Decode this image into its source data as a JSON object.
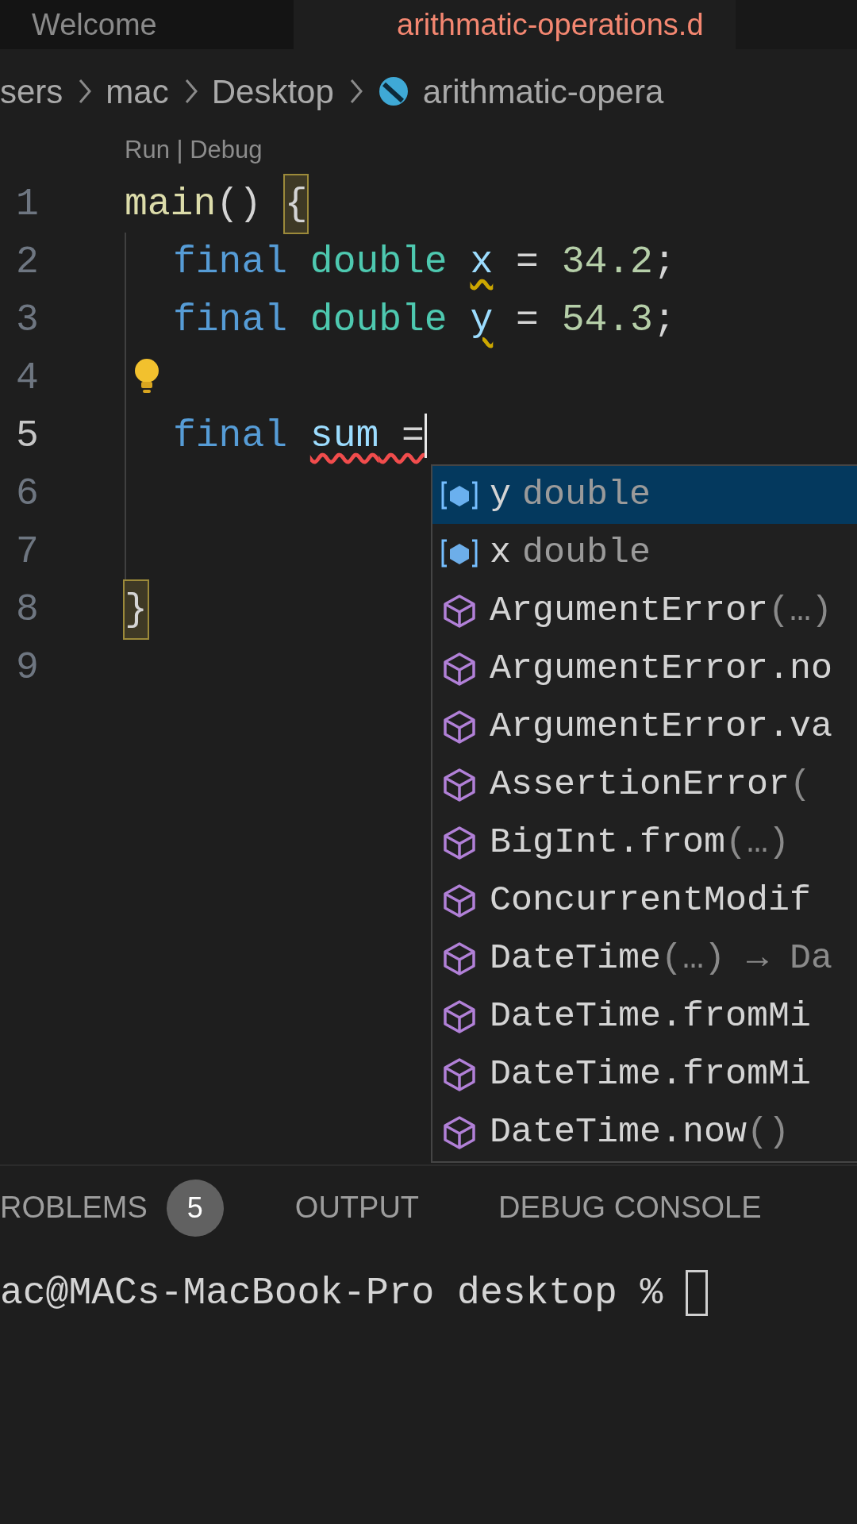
{
  "tabs": [
    {
      "label": "Welcome",
      "selected": false
    },
    {
      "label": "arithmatic-operations.d",
      "selected": true
    }
  ],
  "breadcrumb": [
    {
      "label": "sers",
      "kind": "folder"
    },
    {
      "label": "mac",
      "kind": "folder"
    },
    {
      "label": "Desktop",
      "kind": "folder"
    },
    {
      "label": "arithmatic-opera",
      "kind": "file"
    }
  ],
  "codelens": "Run | Debug",
  "lines": [
    {
      "number": "1",
      "current": false,
      "indented": false,
      "lightbulb": false,
      "cursor": false,
      "tokens": [
        {
          "text": "main",
          "kind": "function"
        },
        {
          "text": "() ",
          "kind": "punct"
        },
        {
          "text": "{",
          "kind": "punct",
          "bracket_match": true
        }
      ]
    },
    {
      "number": "2",
      "current": false,
      "indented": true,
      "lightbulb": false,
      "cursor": false,
      "tokens": [
        {
          "text": "final ",
          "kind": "keyword"
        },
        {
          "text": "double ",
          "kind": "type"
        },
        {
          "text": "x",
          "kind": "variable",
          "warning": true
        },
        {
          "text": " = ",
          "kind": "punct"
        },
        {
          "text": "34.2",
          "kind": "number"
        },
        {
          "text": ";",
          "kind": "punct"
        }
      ]
    },
    {
      "number": "3",
      "current": false,
      "indented": true,
      "lightbulb": false,
      "cursor": false,
      "tokens": [
        {
          "text": "final ",
          "kind": "keyword"
        },
        {
          "text": "double ",
          "kind": "type"
        },
        {
          "text": "y",
          "kind": "variable",
          "warning": true
        },
        {
          "text": " = ",
          "kind": "punct"
        },
        {
          "text": "54.3",
          "kind": "number"
        },
        {
          "text": ";",
          "kind": "punct"
        }
      ]
    },
    {
      "number": "4",
      "current": false,
      "indented": true,
      "lightbulb": true,
      "cursor": false
    },
    {
      "number": "5",
      "current": true,
      "indented": true,
      "lightbulb": false,
      "cursor": true,
      "tokens": [
        {
          "text": "final ",
          "kind": "keyword"
        },
        {
          "text": "sum",
          "kind": "variable",
          "error": true
        },
        {
          "text": " =",
          "kind": "punct",
          "error": true
        }
      ]
    },
    {
      "number": "6",
      "current": false,
      "indented": true,
      "lightbulb": false,
      "cursor": false
    },
    {
      "number": "7",
      "current": false,
      "indented": true,
      "lightbulb": false,
      "cursor": false
    },
    {
      "number": "8",
      "current": false,
      "indented": false,
      "lightbulb": false,
      "cursor": false,
      "tokens": [
        {
          "text": "}",
          "kind": "punct",
          "bracket_match": true
        }
      ]
    },
    {
      "number": "9",
      "current": false,
      "indented": false,
      "lightbulb": false,
      "cursor": false
    }
  ],
  "suggestions": [
    {
      "label": "y",
      "detail": "double",
      "kind": "variable",
      "selected": true
    },
    {
      "label": "x",
      "detail": "double",
      "kind": "variable",
      "selected": false
    },
    {
      "label": "ArgumentError",
      "suffix": "(…)",
      "kind": "class",
      "selected": false
    },
    {
      "label": "ArgumentError.no",
      "kind": "class",
      "selected": false
    },
    {
      "label": "ArgumentError.va",
      "kind": "class",
      "selected": false
    },
    {
      "label": "AssertionError",
      "suffix": "(",
      "kind": "class",
      "selected": false
    },
    {
      "label": "BigInt.from",
      "suffix": "(…)",
      "kind": "class",
      "selected": false
    },
    {
      "label": "ConcurrentModif",
      "kind": "class",
      "selected": false
    },
    {
      "label": "DateTime",
      "suffix": "(…) → Da",
      "kind": "class",
      "selected": false
    },
    {
      "label": "DateTime.fromMi",
      "kind": "class",
      "selected": false
    },
    {
      "label": "DateTime.fromMi",
      "kind": "class",
      "selected": false
    },
    {
      "label": "DateTime.now",
      "suffix": "()",
      "kind": "class",
      "selected": false
    }
  ],
  "panel_tabs": [
    {
      "label": "ROBLEMS",
      "badge": "5"
    },
    {
      "label": "OUTPUT"
    },
    {
      "label": "DEBUG CONSOLE"
    }
  ],
  "terminal": {
    "prompt": "ac@MACs-MacBook-Pro desktop %",
    "cursor": true
  }
}
